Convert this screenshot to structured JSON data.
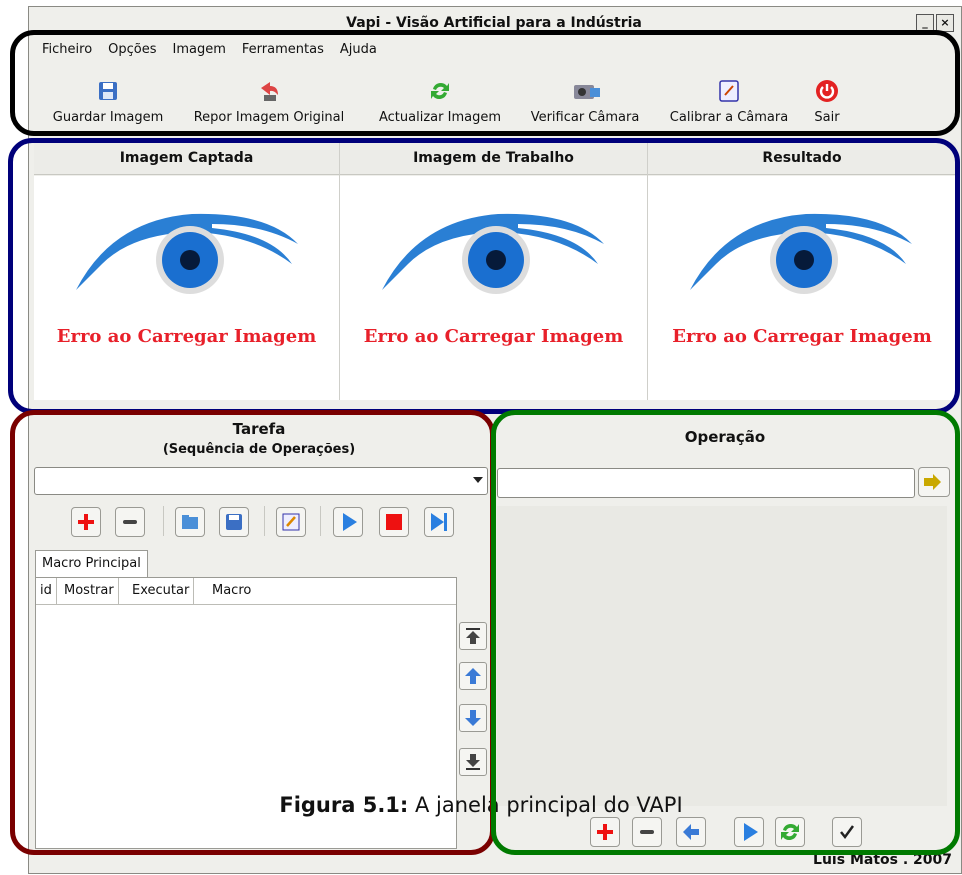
{
  "window": {
    "title": "Vapi - Visão Artificial para a Indústria"
  },
  "menu": [
    "Ficheiro",
    "Opções",
    "Imagem",
    "Ferramentas",
    "Ajuda"
  ],
  "toolbar": {
    "save": "Guardar Imagem",
    "restore": "Repor Imagem Original",
    "refresh": "Actualizar Imagem",
    "check_camera": "Verificar Câmara",
    "calibrate": "Calibrar a Câmara",
    "exit": "Sair"
  },
  "panes": [
    {
      "title": "Imagem Captada",
      "error": "Erro ao Carregar Imagem"
    },
    {
      "title": "Imagem de Trabalho",
      "error": "Erro ao Carregar Imagem"
    },
    {
      "title": "Resultado",
      "error": "Erro ao Carregar Imagem"
    }
  ],
  "task": {
    "title": "Tarefa",
    "subtitle": "(Sequência de Operações)",
    "tab": "Macro Principal",
    "columns": [
      "id",
      "Mostrar",
      "Executar",
      "Macro"
    ]
  },
  "operation": {
    "title": "Operação"
  },
  "caption": {
    "bold": "Figura 5.1:",
    "text": " A janela principal do VAPI"
  },
  "status": "Luis Matos . 2007",
  "colors": {
    "annot_toolbar": "#000000",
    "annot_images": "#00007a",
    "annot_task": "#7a0000",
    "annot_operation": "#007a00",
    "error_text": "#e8202a"
  }
}
